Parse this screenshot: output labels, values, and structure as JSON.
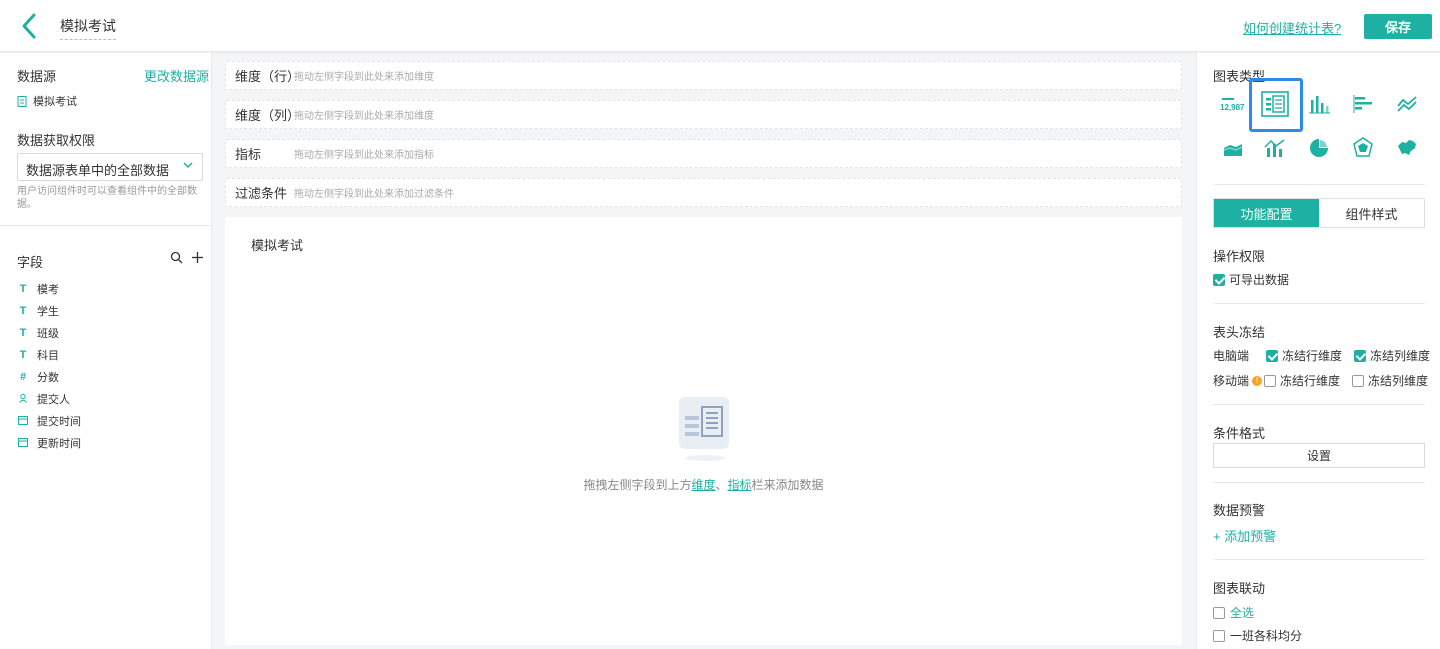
{
  "header": {
    "title": "模拟考试",
    "help_link": "如何创建统计表?",
    "save_label": "保存"
  },
  "left": {
    "datasource_title": "数据源",
    "change_source": "更改数据源",
    "source_name": "模拟考试",
    "permission_title": "数据获取权限",
    "permission_value": "数据源表单中的全部数据",
    "permission_hint": "用户访问组件时可以查看组件中的全部数据。",
    "fields_title": "字段",
    "fields": [
      {
        "type": "T",
        "icon": "text-icon",
        "label": "模考"
      },
      {
        "type": "T",
        "icon": "text-icon",
        "label": "学生"
      },
      {
        "type": "T",
        "icon": "text-icon",
        "label": "班级"
      },
      {
        "type": "T",
        "icon": "text-icon",
        "label": "科目"
      },
      {
        "type": "#",
        "icon": "number-icon",
        "label": "分数"
      },
      {
        "type": "user",
        "icon": "user-icon",
        "label": "提交人"
      },
      {
        "type": "date",
        "icon": "calendar-icon",
        "label": "提交时间"
      },
      {
        "type": "date",
        "icon": "calendar-icon",
        "label": "更新时间"
      }
    ]
  },
  "center": {
    "drop_rows": [
      {
        "label": "维度（行）",
        "hint": "拖动左侧字段到此处来添加维度"
      },
      {
        "label": "维度（列）",
        "hint": "拖动左侧字段到此处来添加维度"
      },
      {
        "label": "指标",
        "hint": "拖动左侧字段到此处来添加指标"
      },
      {
        "label": "过滤条件",
        "hint": "拖动左侧字段到此处来添加过滤条件"
      }
    ],
    "canvas_title": "模拟考试",
    "empty_prefix": "拖拽左侧字段到上方",
    "empty_link1": "维度",
    "empty_sep": "、",
    "empty_link2": "指标",
    "empty_suffix": "栏来添加数据"
  },
  "right": {
    "chart_type_title": "图表类型",
    "kpi_number": "12,987",
    "chart_types": [
      "indicator-card-icon",
      "pivot-table-icon",
      "bar-chart-icon",
      "horizontal-bar-icon",
      "line-chart-icon",
      "area-chart-icon",
      "combo-chart-icon",
      "pie-chart-icon",
      "radar-chart-icon",
      "map-icon"
    ],
    "tab_function": "功能配置",
    "tab_style": "组件样式",
    "op_perm_title": "操作权限",
    "exportable": "可导出数据",
    "freeze_title": "表头冻结",
    "pc_label": "电脑端",
    "mobile_label": "移动端",
    "freeze_row": "冻结行维度",
    "freeze_col": "冻结列维度",
    "cond_format_title": "条件格式",
    "setting_label": "设置",
    "warn_title": "数据预警",
    "add_warn": "添加预警",
    "link_title": "图表联动",
    "select_all": "全选",
    "link_item": "一班各科均分"
  },
  "colors": {
    "accent": "#1eb0a2",
    "selected_border": "#2a8ce8"
  }
}
